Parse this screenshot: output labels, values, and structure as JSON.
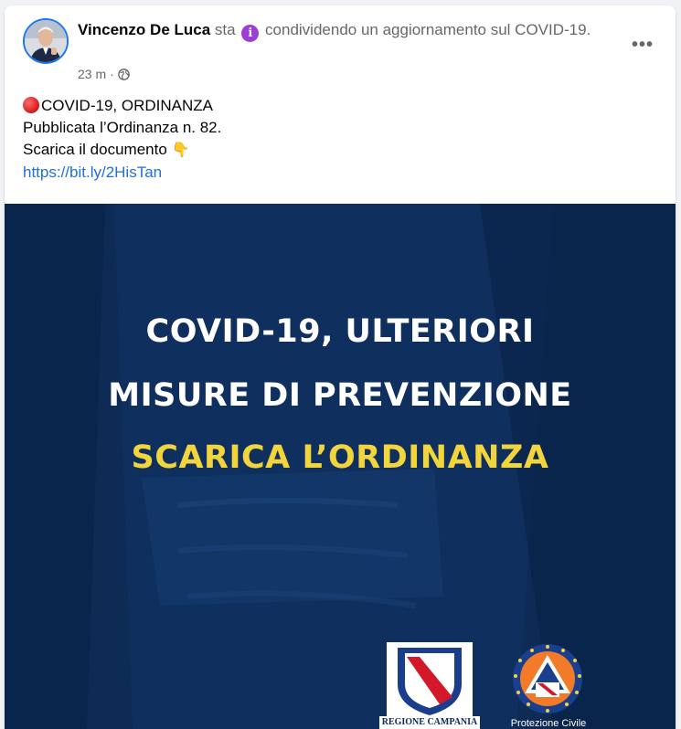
{
  "post": {
    "author": "Vincenzo De Luca",
    "verb": " sta ",
    "activity": " condividendo un aggiornamento sul COVID-19.",
    "info_icon": "info-icon",
    "time": "23 m",
    "separator": " · ",
    "privacy_icon": "globe-icon",
    "more_icon": "more-options-icon",
    "headline_text": "COVID-19, ORDINANZA",
    "line1": "Pubblicata l’Ordinanza n. 82.",
    "line2": "Scarica il documento",
    "hand_emoji": "👇",
    "link": "https://bit.ly/2HisTan"
  },
  "image": {
    "title1": "COVID-19, ULTERIORI",
    "title2": "MISURE DI PREVENZIONE",
    "title3": "SCARICA L’ORDINANZA",
    "logo1_caption": "REGIONE CAMPANIA",
    "logo2_caption": "Protezione Civile",
    "background_color": "#0d2b55",
    "highlight_color": "#f2d43d"
  }
}
